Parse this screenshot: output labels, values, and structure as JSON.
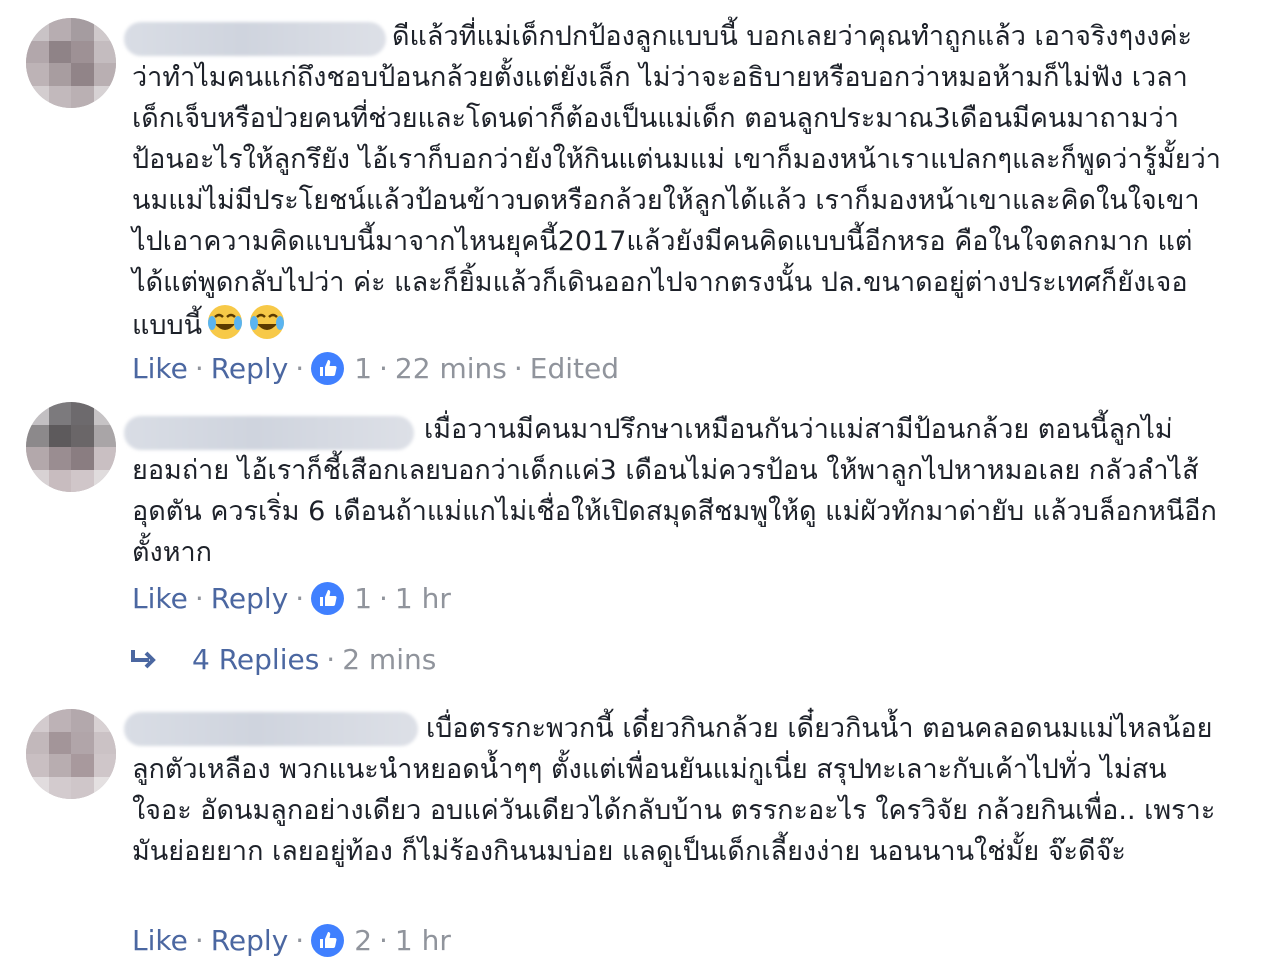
{
  "comments": [
    {
      "text": "ดีแล้วที่แม่เด็กปกป้องลูกแบบนี้ บอกเลยว่าคุณทำถูกแล้ว เอาจริงๆงงค่ะว่าทำไมคนแก่ถึงชอบป้อนกล้วยตั้งแต่ยังเล็ก ไม่ว่าจะอธิบายหรือบอกว่าหมอห้ามก็ไม่ฟัง เวลาเด็กเจ็บหรือป่วยคนที่ช่วยและโดนด่าก็ต้องเป็นแม่เด็ก ตอนลูกประมาณ3เดือนมีคนมาถามว่าป้อนอะไรให้ลูกรึยัง ไอ้เราก็บอกว่ายังให้กินแต่นมแม่ เขาก็มองหน้าเราแปลกๆและก็พูดว่ารู้มั้ยว่านมแม่ไม่มีประโยชน์แล้วป้อนข้าวบดหรือกล้วยให้ลูกได้แล้ว เราก็มองหน้าเขาและคิดในใจเขาไปเอาความคิดแบบนี้มาจากไหนยุคนี้2017แล้วยังมีคนคิดแบบนี้อีกหรอ คือในใจตลกมาก แต่ได้แต่พูดกลับไปว่า ค่ะ และก็ยิ้มแล้วก็เดินออกไปจากตรงนั้น ปล.ขนาดอยู่ต่างประเทศก็ยังเจอแบบนี้",
      "emoji_count": 2,
      "like_label": "Like",
      "reply_label": "Reply",
      "reaction_count": "1",
      "time": "22 mins",
      "edited": "Edited"
    },
    {
      "text": "เมื่อวานมีคนมาปรึกษาเหมือนกันว่าแม่สามีป้อนกล้วย ตอนนี้ลูกไม่ยอมถ่าย ไอ้เราก็ชี้เสือกเลยบอกว่าเด็กแค่3 เดือนไม่ควรป้อน ให้พาลูกไปหาหมอเลย กลัวลำไส้อุดตัน ควรเริ่ม 6 เดือนถ้าแม่แกไม่เชื่อให้เปิดสมุดสีชมพูให้ดู แม่ผัวทักมาด่ายับ แล้วบล็อกหนีอีกตั้งหาก",
      "like_label": "Like",
      "reply_label": "Reply",
      "reaction_count": "1",
      "time": "1 hr",
      "replies_label": "4 Replies",
      "replies_time": "2 mins"
    },
    {
      "text": "เบื่อตรรกะพวกนี้ เดี๋ยวกินกล้วย เดี๋ยวกินน้ำ ตอนคลอดนมแม่ไหลน้อย ลูกตัวเหลือง พวกแนะนำหยอดน้ำๆๆ ตั้งแต่เพื่อนยันแม่กูเนี่ย สรุปทะเลาะกับเค้าไปทั่ว ไม่สนใจอะ อัดนมลูกอย่างเดียว อบแค่วันเดียวได้กลับบ้าน ตรรกะอะไร ใครวิจัย กล้วยกินเพื่อ.. เพราะมันย่อยยาก เลยอยู่ท้อง ก็ไม่ร้องกินนมบ่อย แลดูเป็นเด็กเลี้ยงง่าย นอนนานใช่มั้ย จ๊ะดีจ๊ะ",
      "like_label": "Like",
      "reply_label": "Reply",
      "reaction_count": "2",
      "time": "1 hr"
    }
  ],
  "icons": {
    "reaction": "like-thumb-icon",
    "replies": "reply-arrow-icon",
    "emoji": "tears-of-joy-emoji-icon"
  },
  "colors": {
    "link": "#4b67a1",
    "muted": "#90949c",
    "text": "#1d2129",
    "like_blue": "#4080ff"
  }
}
